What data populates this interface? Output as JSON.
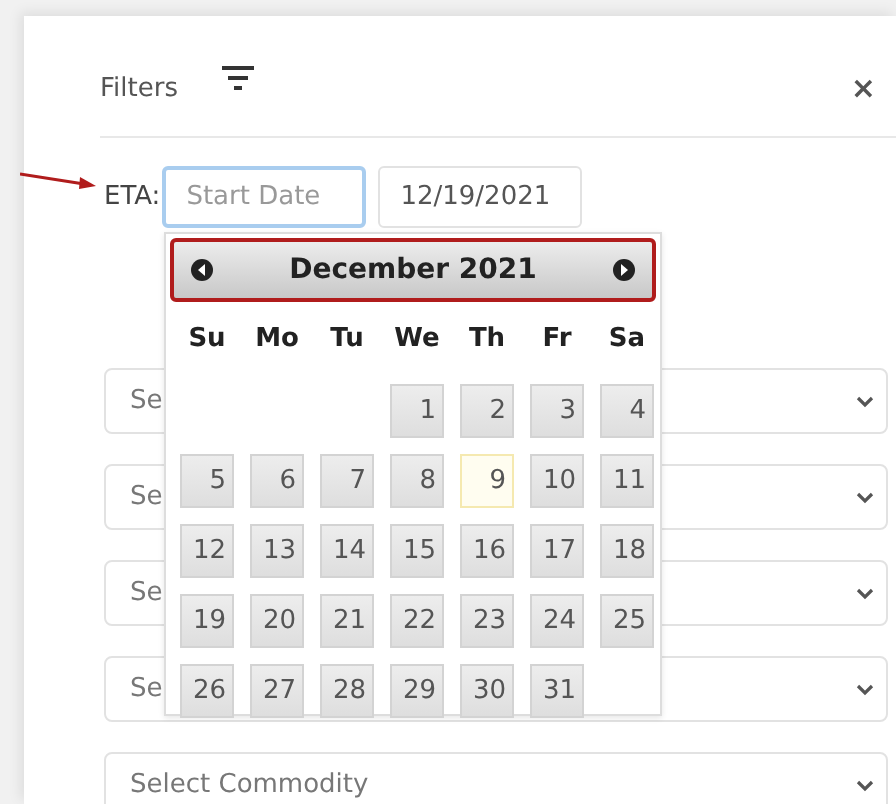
{
  "header": {
    "title": "Filters",
    "close": "×"
  },
  "eta": {
    "label": "ETA:",
    "start": {
      "placeholder": "Start Date",
      "focused": true
    },
    "end": {
      "value": "12/19/2021",
      "focused": false
    }
  },
  "calendar": {
    "month": "December 2021",
    "weekdays": [
      "Su",
      "Mo",
      "Tu",
      "We",
      "Th",
      "Fr",
      "Sa"
    ],
    "weeks": [
      [
        {
          "day": "1",
          "today": false
        },
        {
          "day": "2",
          "today": false
        },
        {
          "day": "3",
          "today": false
        },
        {
          "day": "4",
          "today": false
        }
      ],
      [
        {
          "day": "5",
          "today": false
        },
        {
          "day": "6",
          "today": false
        },
        {
          "day": "7",
          "today": false
        },
        {
          "day": "8",
          "today": false
        },
        {
          "day": "9",
          "today": true
        },
        {
          "day": "10",
          "today": false
        },
        {
          "day": "11",
          "today": false
        }
      ],
      [
        {
          "day": "12",
          "today": false
        },
        {
          "day": "13",
          "today": false
        },
        {
          "day": "14",
          "today": false
        },
        {
          "day": "15",
          "today": false
        },
        {
          "day": "16",
          "today": false
        },
        {
          "day": "17",
          "today": false
        },
        {
          "day": "18",
          "today": false
        }
      ],
      [
        {
          "day": "19",
          "today": false
        },
        {
          "day": "20",
          "today": false
        },
        {
          "day": "21",
          "today": false
        },
        {
          "day": "22",
          "today": false
        },
        {
          "day": "23",
          "today": false
        },
        {
          "day": "24",
          "today": false
        },
        {
          "day": "25",
          "today": false
        }
      ],
      [
        {
          "day": "26",
          "today": false
        },
        {
          "day": "27",
          "today": false
        },
        {
          "day": "28",
          "today": false
        },
        {
          "day": "29",
          "today": false
        },
        {
          "day": "30",
          "today": false
        },
        {
          "day": "31",
          "today": false
        }
      ]
    ]
  },
  "selects": [
    {
      "placeholder": "Se"
    },
    {
      "placeholder": "Se"
    },
    {
      "placeholder": "Se"
    },
    {
      "placeholder": "Se"
    },
    {
      "placeholder": "Select Commodity"
    }
  ]
}
